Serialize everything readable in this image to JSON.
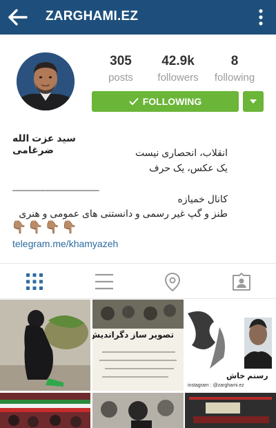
{
  "header": {
    "username": "ZARGHAMI.EZ",
    "background": "#1e4f7c",
    "back_icon": "back-arrow-icon",
    "more_icon": "more-vertical-icon"
  },
  "stats": {
    "posts": {
      "value": "305",
      "label": "posts"
    },
    "followers": {
      "value": "42.9k",
      "label": "followers"
    },
    "following": {
      "value": "8",
      "label": "following"
    }
  },
  "follow_button": {
    "label": "FOLLOWING",
    "color": "#6bb539",
    "icon": "check-icon",
    "dropdown_icon": "caret-down-icon"
  },
  "profile": {
    "full_name": "سید عزت الله ضرغامی",
    "bio_line_1": "انقلاب، انحصاری نیست",
    "bio_line_2": "یک عکس، یک حرف",
    "divider": "____________________",
    "bio_line_3": "کانال خمیازه",
    "bio_line_4": "طنز و گپ غیر رسمی و دانستنی های عمومی و هنری",
    "emojis": [
      "👇🏽",
      "👇🏽",
      "👇🏽",
      "👇🏽"
    ],
    "link": "telegram.me/khamyazeh",
    "link_color": "#2b6a9e"
  },
  "tabs": [
    {
      "name": "grid",
      "icon": "grid-icon",
      "active": true
    },
    {
      "name": "list",
      "icon": "list-icon",
      "active": false
    },
    {
      "name": "map",
      "icon": "location-pin-icon",
      "active": false
    },
    {
      "name": "tagged",
      "icon": "tagged-person-icon",
      "active": false
    }
  ],
  "posts": {
    "p2_title": "تصویر ساز دگراندیش!",
    "p3_name": "رستم خاش",
    "p3_caption": "instagram : @zarghami.ez"
  }
}
